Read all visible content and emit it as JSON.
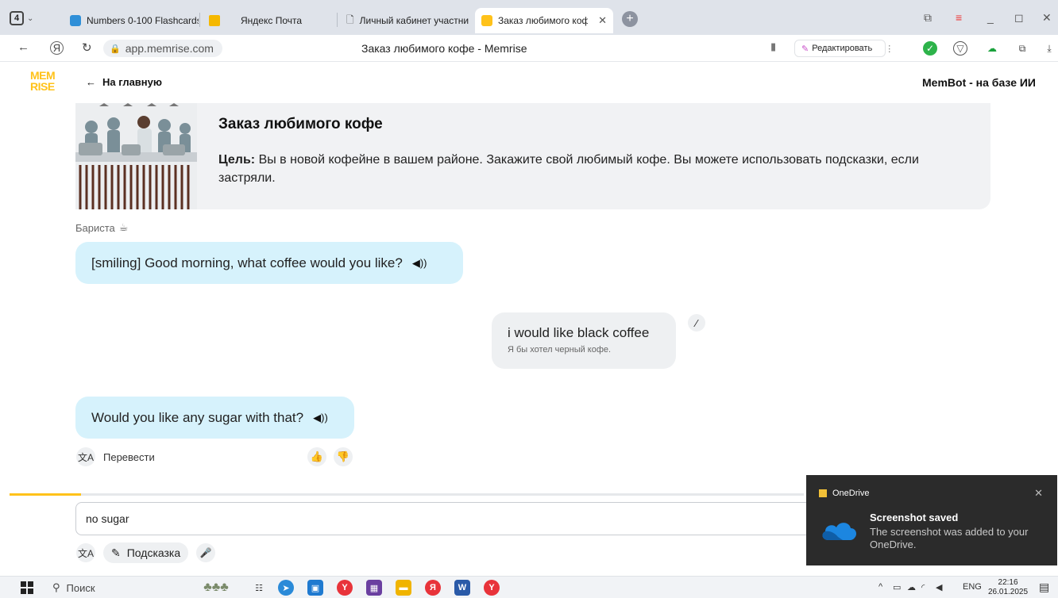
{
  "browser": {
    "tab_count": "4",
    "tabs": [
      {
        "label": "Numbers 0-100 Flashcards",
        "color": "#2f8fd8"
      },
      {
        "label": "",
        "color": "#f5b800"
      },
      {
        "label": "Яндекс Почта",
        "color": ""
      },
      {
        "label": "Личный кабинет участни",
        "color": "#555555"
      },
      {
        "label": "Заказ любимого кофе",
        "color": "#ffc21a",
        "active": true
      }
    ],
    "url": "app.memrise.com",
    "page_title": "Заказ любимого кофе - Memrise",
    "edit_label": "Редактировать"
  },
  "app": {
    "logo_line1": "MEM",
    "logo_line2": "RISE",
    "back_label": "На главную",
    "assistant_label": "MemBot - на базе ИИ",
    "accent": "#ffc21a"
  },
  "scenario": {
    "title": "Заказ любимого кофе",
    "goal_prefix": "Цель:",
    "goal_text": "Вы в новой кофейне в вашем районе. Закажите свой любимый кофе. Вы можете использовать подсказки, если застряли."
  },
  "chat": {
    "speaker": "Бариста",
    "messages": [
      {
        "from": "bot",
        "text": "[smiling] Good morning, what coffee would you like?"
      },
      {
        "from": "user",
        "text": "i would like black coffee",
        "translation": "Я бы хотел черный кофе."
      },
      {
        "from": "bot",
        "text": "Would you like any sugar with that?"
      }
    ],
    "translate_label": "Перевести"
  },
  "composer": {
    "progress": 0.09,
    "input_value": "no sugar",
    "hint_label": "Подсказка"
  },
  "toast": {
    "app": "OneDrive",
    "title": "Screenshot saved",
    "body": "The screenshot was added to your OneDrive."
  },
  "taskbar": {
    "search_label": "Поиск",
    "lang": "ENG",
    "time": "22:16",
    "date": "26.01.2025"
  }
}
